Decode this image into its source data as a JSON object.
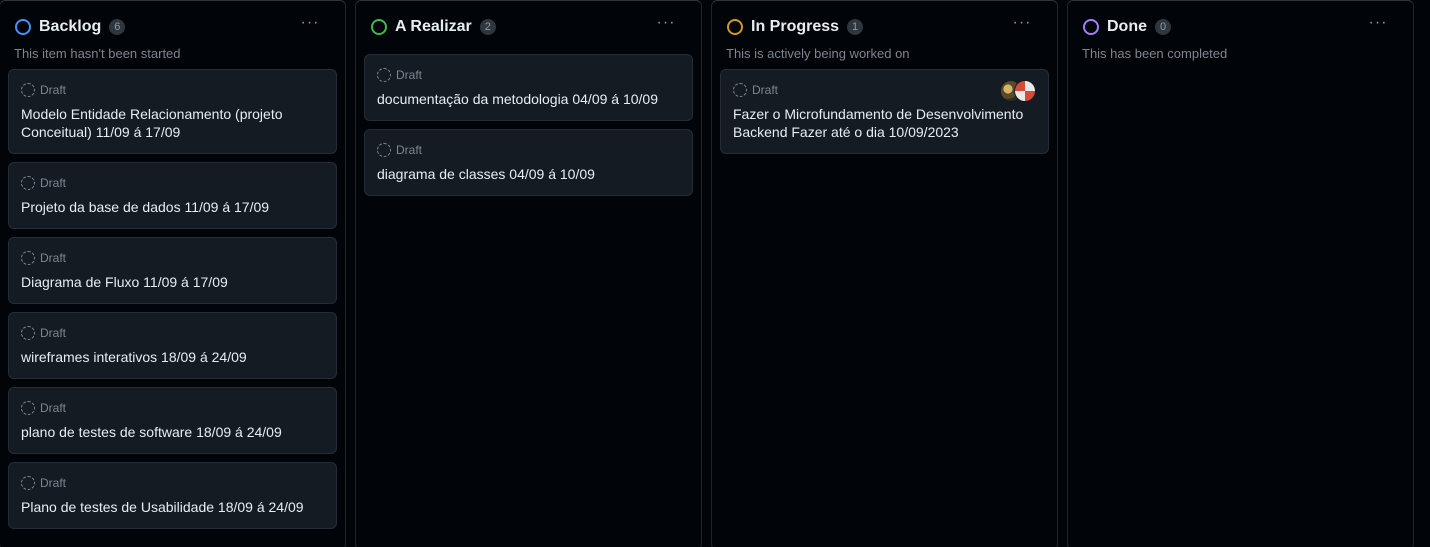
{
  "board": {
    "columns": [
      {
        "title": "Backlog",
        "count": "6",
        "description": "This item hasn't been started",
        "color": "#4493f8",
        "more": "···",
        "cards": [
          {
            "status": "Draft",
            "title": "Modelo Entidade Relacionamento (projeto Conceitual) 11/09 á 17/09"
          },
          {
            "status": "Draft",
            "title": "Projeto da base de dados 11/09 á 17/09"
          },
          {
            "status": "Draft",
            "title": "Diagrama de Fluxo 11/09 á 17/09"
          },
          {
            "status": "Draft",
            "title": "wireframes interativos 18/09 á 24/09"
          },
          {
            "status": "Draft",
            "title": "plano de testes de software 18/09 á 24/09"
          },
          {
            "status": "Draft",
            "title": "Plano de testes de Usabilidade 18/09 á 24/09"
          }
        ]
      },
      {
        "title": "A Realizar",
        "count": "2",
        "description": "",
        "color": "#3fb950",
        "more": "···",
        "cards": [
          {
            "status": "Draft",
            "title": "documentação da metodologia 04/09 á 10/09"
          },
          {
            "status": "Draft",
            "title": "diagrama de classes 04/09 á 10/09"
          }
        ]
      },
      {
        "title": "In Progress",
        "count": "1",
        "description": "This is actively being worked on",
        "color": "#d29922",
        "more": "···",
        "cards": [
          {
            "status": "Draft",
            "title": "Fazer o Microfundamento de Desenvolvimento Backend Fazer até o dia 10/09/2023",
            "assignees": [
              "avatar-a",
              "avatar-b"
            ]
          }
        ]
      },
      {
        "title": "Done",
        "count": "0",
        "description": "This has been completed",
        "color": "#ab7df8",
        "more": "···",
        "cards": []
      }
    ]
  }
}
